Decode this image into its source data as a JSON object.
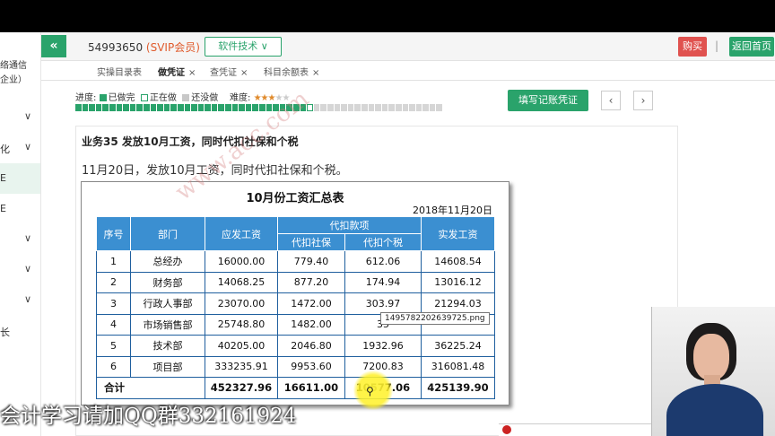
{
  "sidebar": {
    "org_lines": [
      "络通信",
      "企业）"
    ],
    "items": [
      {
        "label": "",
        "has_chevron": true
      },
      {
        "label": "化",
        "has_chevron": true
      },
      {
        "label": "E",
        "has_chevron": false,
        "active": true
      },
      {
        "label": "E",
        "has_chevron": false
      },
      {
        "label": "",
        "has_chevron": true
      },
      {
        "label": "",
        "has_chevron": true
      },
      {
        "label": "",
        "has_chevron": true
      },
      {
        "label": "长",
        "has_chevron": false
      }
    ]
  },
  "header": {
    "collapse_icon": "«",
    "account_id": "54993650",
    "account_badge": "(SVIP会员)",
    "tech_menu": "软件技术 ∨",
    "buy_label": "购买",
    "separator": "|",
    "back_label": "返回首页"
  },
  "tabs": [
    {
      "label": "实操目录表",
      "closable": false,
      "active": false
    },
    {
      "label": "做凭证",
      "closable": true,
      "active": true
    },
    {
      "label": "查凭证",
      "closable": true,
      "active": false
    },
    {
      "label": "科目余额表",
      "closable": true,
      "active": false
    }
  ],
  "progress": {
    "label": "进度:",
    "done_label": "已做完",
    "doing_label": "正在做",
    "todo_label": "还没做",
    "difficulty_label": "难度:",
    "difficulty": 3,
    "difficulty_max": 5,
    "done_count": 34,
    "doing_index": 35,
    "total_cells": 54
  },
  "actions": {
    "write_voucher": "填写记账凭证",
    "prev": "‹",
    "next": "›"
  },
  "task": {
    "title": "业务35 发放10月工资，同时代扣社保和个税",
    "description": "11月20日，发放10月工资，同时代扣社保和个税。"
  },
  "sheet": {
    "title": "10月份工资汇总表",
    "date": "2018年11月20日",
    "headers": {
      "seq": "序号",
      "dept": "部门",
      "gross": "应发工资",
      "withhold": "代扣款项",
      "social": "代扣社保",
      "tax": "代扣个税",
      "net": "实发工资"
    },
    "rows": [
      {
        "seq": "1",
        "dept": "总经办",
        "gross": "16000.00",
        "social": "779.40",
        "tax": "612.06",
        "net": "14608.54"
      },
      {
        "seq": "2",
        "dept": "财务部",
        "gross": "14068.25",
        "social": "877.20",
        "tax": "174.94",
        "net": "13016.12"
      },
      {
        "seq": "3",
        "dept": "行政人事部",
        "gross": "23070.00",
        "social": "1472.00",
        "tax": "303.97",
        "net": "21294.03"
      },
      {
        "seq": "4",
        "dept": "市场销售部",
        "gross": "25748.80",
        "social": "1482.00",
        "tax": "35",
        "net": ""
      },
      {
        "seq": "5",
        "dept": "技术部",
        "gross": "40205.00",
        "social": "2046.80",
        "tax": "1932.96",
        "net": "36225.24"
      },
      {
        "seq": "6",
        "dept": "项目部",
        "gross": "333235.91",
        "social": "9953.60",
        "tax": "7200.83",
        "net": "316081.48"
      }
    ],
    "total": {
      "label": "合计",
      "gross": "452327.96",
      "social": "16611.00",
      "tax": "10577.06",
      "net": "425139.90"
    },
    "watermark": "www.acc.com",
    "tooltip": "1495782202639725.png"
  },
  "banner": "会计学习请加QQ群332161924"
}
